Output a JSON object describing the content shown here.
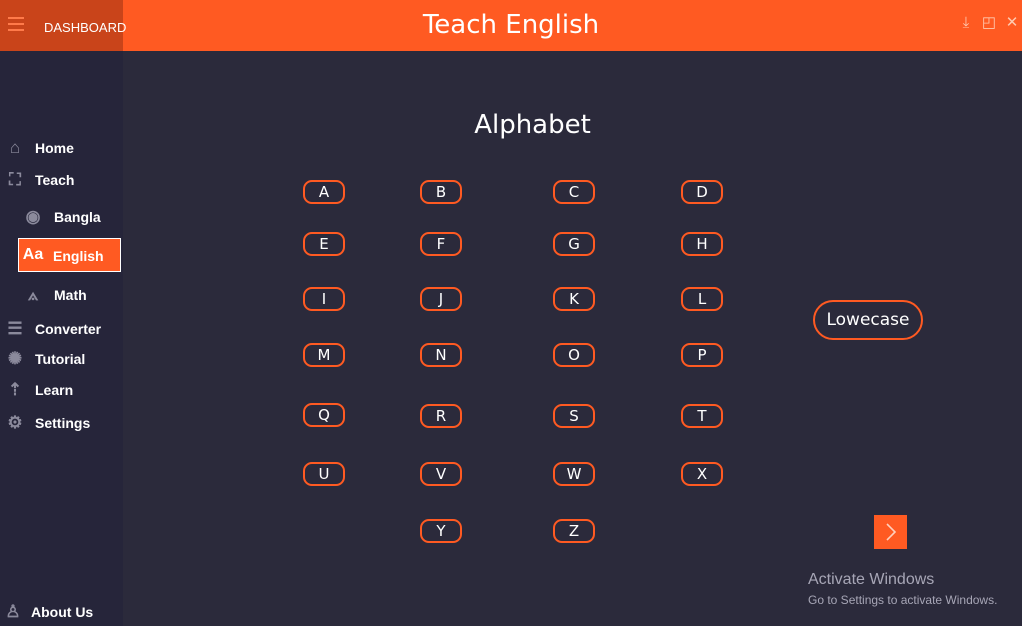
{
  "header": {
    "dashboard_label": "DASHBOARD",
    "app_title": "Teach English"
  },
  "sidebar": {
    "home": "Home",
    "teach": "Teach",
    "bangla": "Bangla",
    "english": "English",
    "math": "Math",
    "converter": "Converter",
    "tutorial": "Tutorial",
    "learn": "Learn",
    "settings": "Settings",
    "about": "About Us"
  },
  "main": {
    "title": "Alphabet",
    "letters": [
      "A",
      "B",
      "C",
      "D",
      "E",
      "F",
      "G",
      "H",
      "I",
      "J",
      "K",
      "L",
      "M",
      "N",
      "O",
      "P",
      "Q",
      "R",
      "S",
      "T",
      "U",
      "V",
      "W",
      "X",
      "Y",
      "Z"
    ],
    "lowercase_label": "Lowecase"
  },
  "watermark": {
    "title": "Activate Windows",
    "subtitle": "Go to Settings to activate Windows."
  },
  "colors": {
    "accent": "#ff5a22",
    "background": "#2b2a3b",
    "sidebar": "#26253a"
  }
}
